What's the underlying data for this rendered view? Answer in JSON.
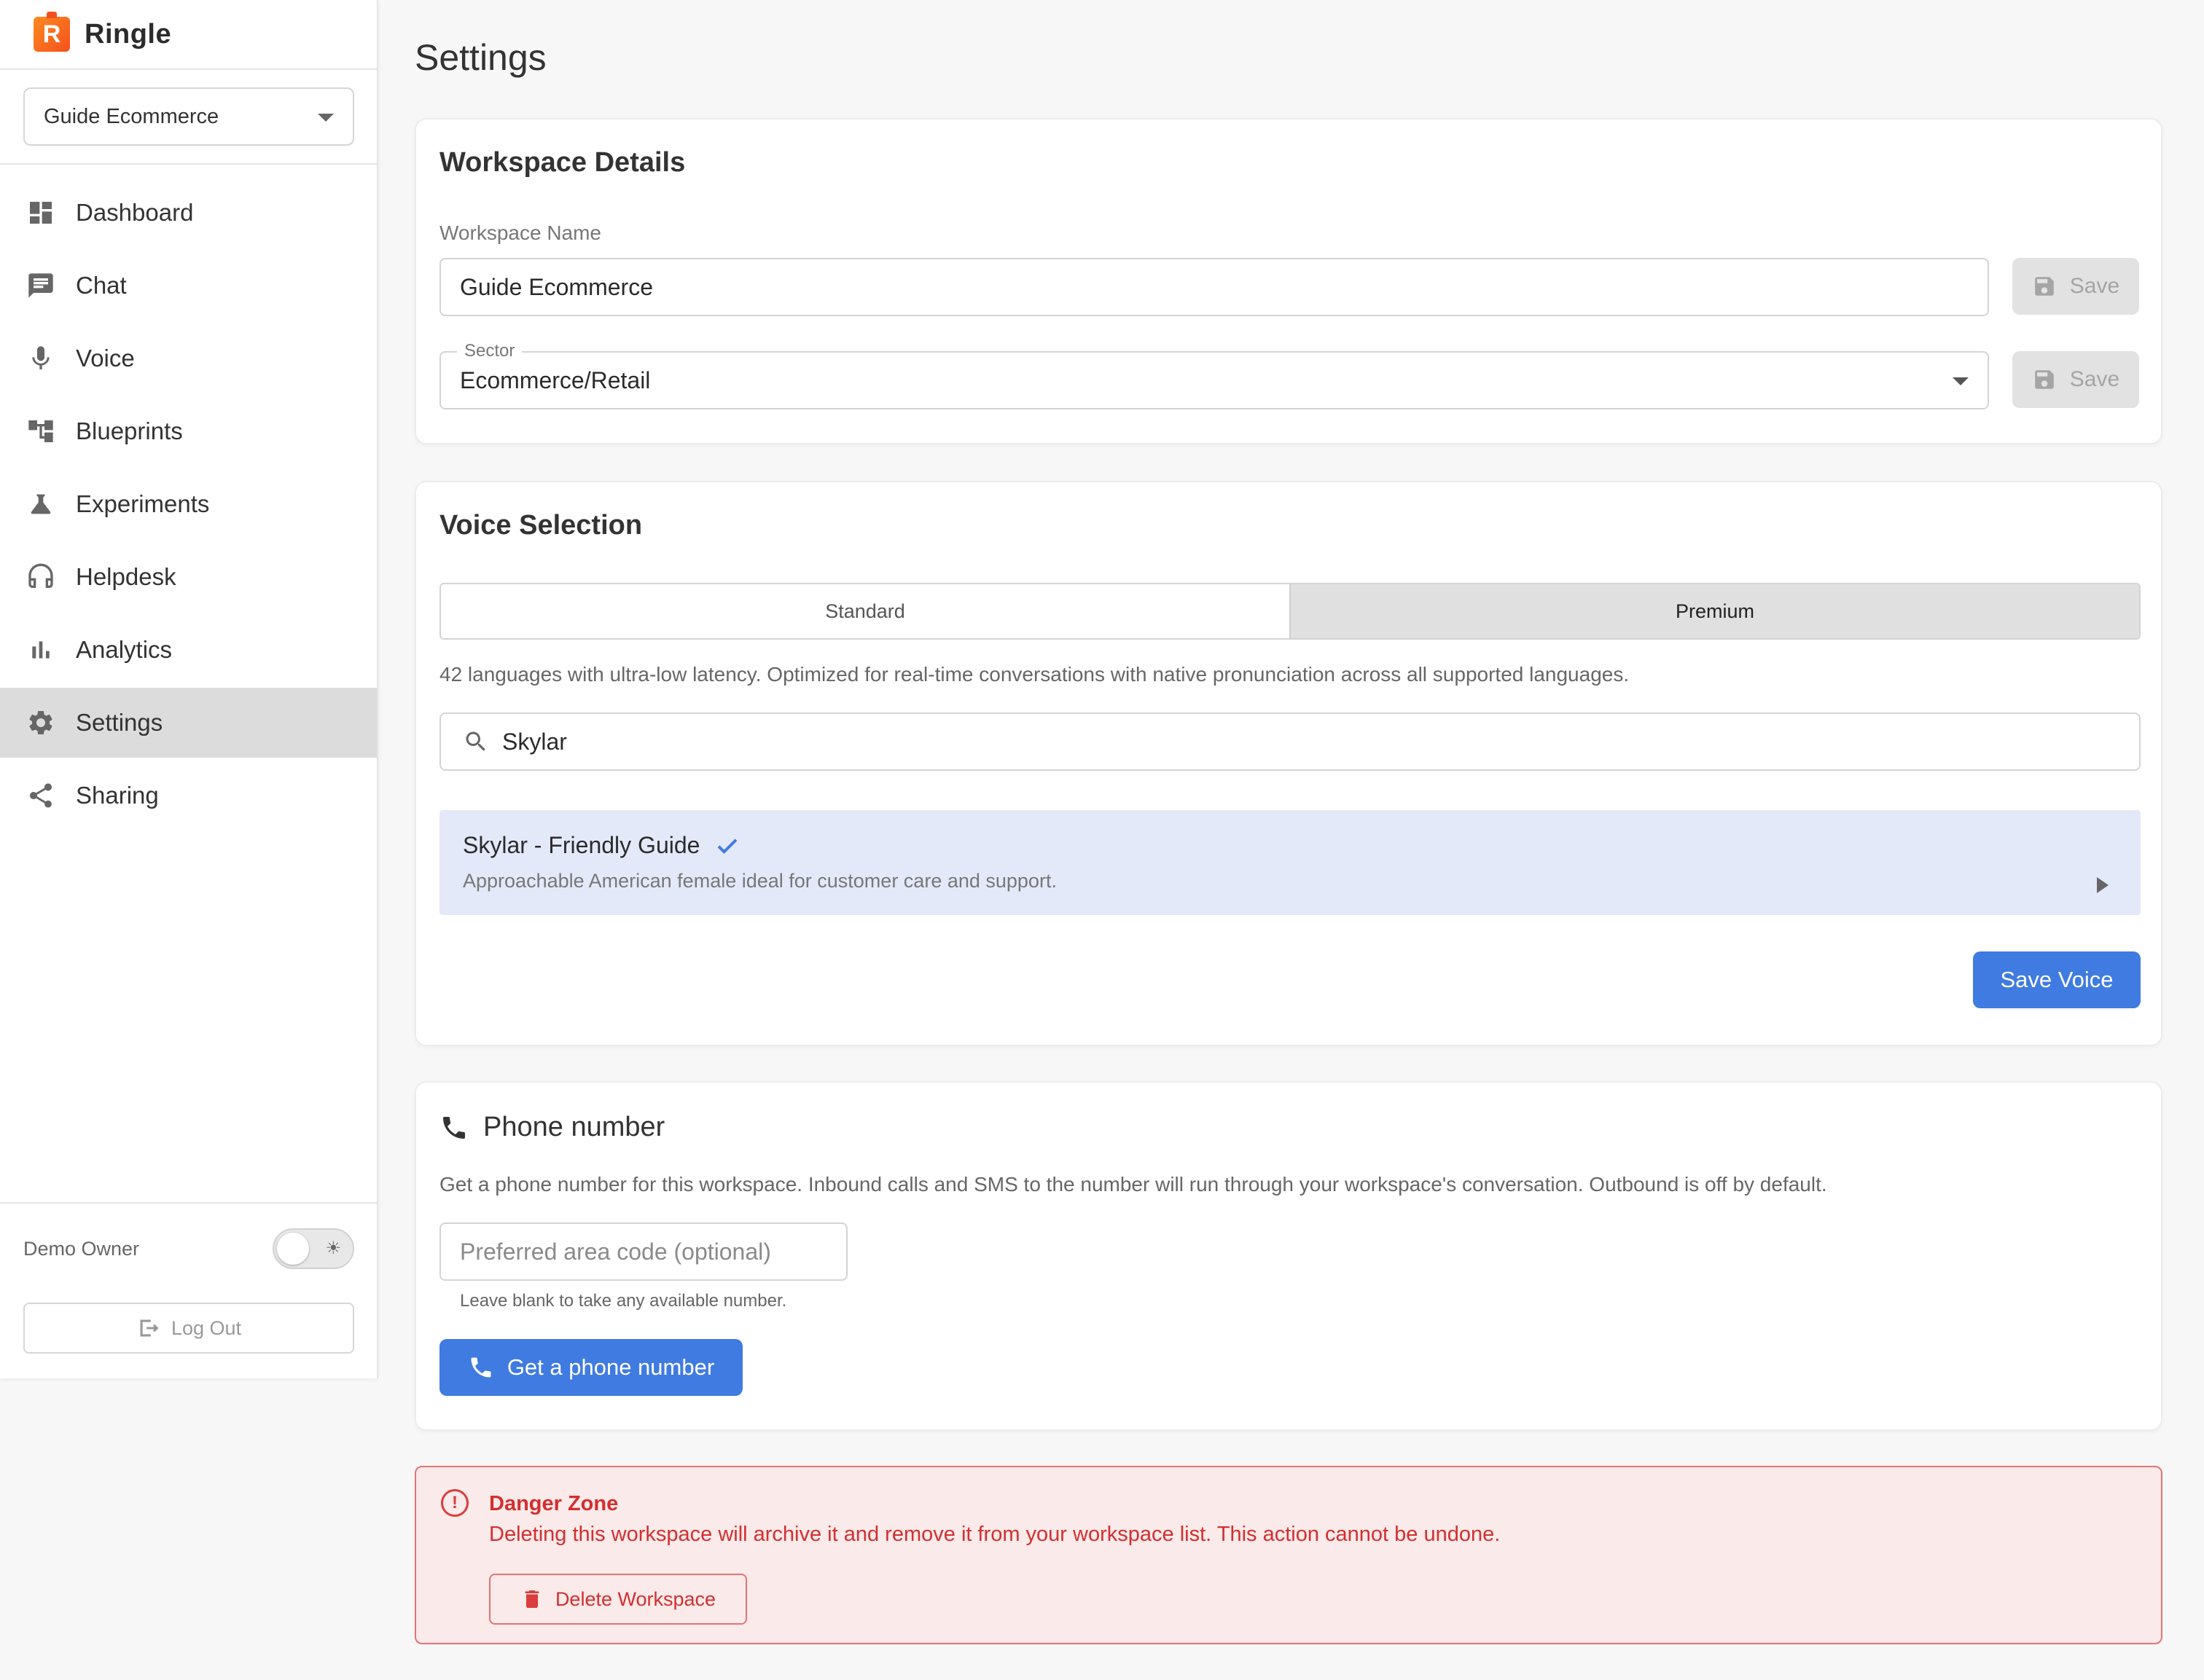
{
  "brand": {
    "name": "Ringle",
    "logo_letter": "R",
    "logo_colors": [
      "#ff8a1f",
      "#f4511e"
    ]
  },
  "sidebar": {
    "workspace_selector": {
      "value": "Guide Ecommerce"
    },
    "items": [
      {
        "label": "Dashboard",
        "icon": "dashboard-icon",
        "active": false
      },
      {
        "label": "Chat",
        "icon": "chat-icon",
        "active": false
      },
      {
        "label": "Voice",
        "icon": "mic-icon",
        "active": false
      },
      {
        "label": "Blueprints",
        "icon": "blueprint-icon",
        "active": false
      },
      {
        "label": "Experiments",
        "icon": "flask-icon",
        "active": false
      },
      {
        "label": "Helpdesk",
        "icon": "headset-icon",
        "active": false
      },
      {
        "label": "Analytics",
        "icon": "bar-chart-icon",
        "active": false
      },
      {
        "label": "Settings",
        "icon": "gear-icon",
        "active": true
      },
      {
        "label": "Sharing",
        "icon": "share-icon",
        "active": false
      }
    ],
    "user": {
      "name": "Demo Owner",
      "theme_toggle": "light"
    },
    "logout_label": "Log Out"
  },
  "page": {
    "title": "Settings"
  },
  "workspace_details": {
    "title": "Workspace Details",
    "name_label": "Workspace Name",
    "name_value": "Guide Ecommerce",
    "sector_label": "Sector",
    "sector_value": "Ecommerce/Retail",
    "save_label": "Save"
  },
  "voice_selection": {
    "title": "Voice Selection",
    "tabs": [
      {
        "label": "Standard",
        "selected": false
      },
      {
        "label": "Premium",
        "selected": true
      }
    ],
    "description": "42 languages with ultra-low latency. Optimized for real-time conversations with native pronunciation across all supported languages.",
    "search_value": "Skylar",
    "selected_voice": {
      "name": "Skylar - Friendly Guide",
      "description": "Approachable American female ideal for customer care and support."
    },
    "save_label": "Save Voice"
  },
  "phone_number": {
    "title": "Phone number",
    "description": "Get a phone number for this workspace. Inbound calls and SMS to the number will run through your workspace's conversation. Outbound is off by default.",
    "area_code_placeholder": "Preferred area code (optional)",
    "area_code_helper": "Leave blank to take any available number.",
    "button_label": "Get a phone number"
  },
  "danger_zone": {
    "title": "Danger Zone",
    "text": "Deleting this workspace will archive it and remove it from your workspace list. This action cannot be undone.",
    "button_label": "Delete Workspace"
  },
  "colors": {
    "accent": "#3f7be0",
    "danger": "#d32f2f",
    "selected_voice_bg": "#e3e9f9",
    "active_nav_bg": "#dcdcdc"
  }
}
